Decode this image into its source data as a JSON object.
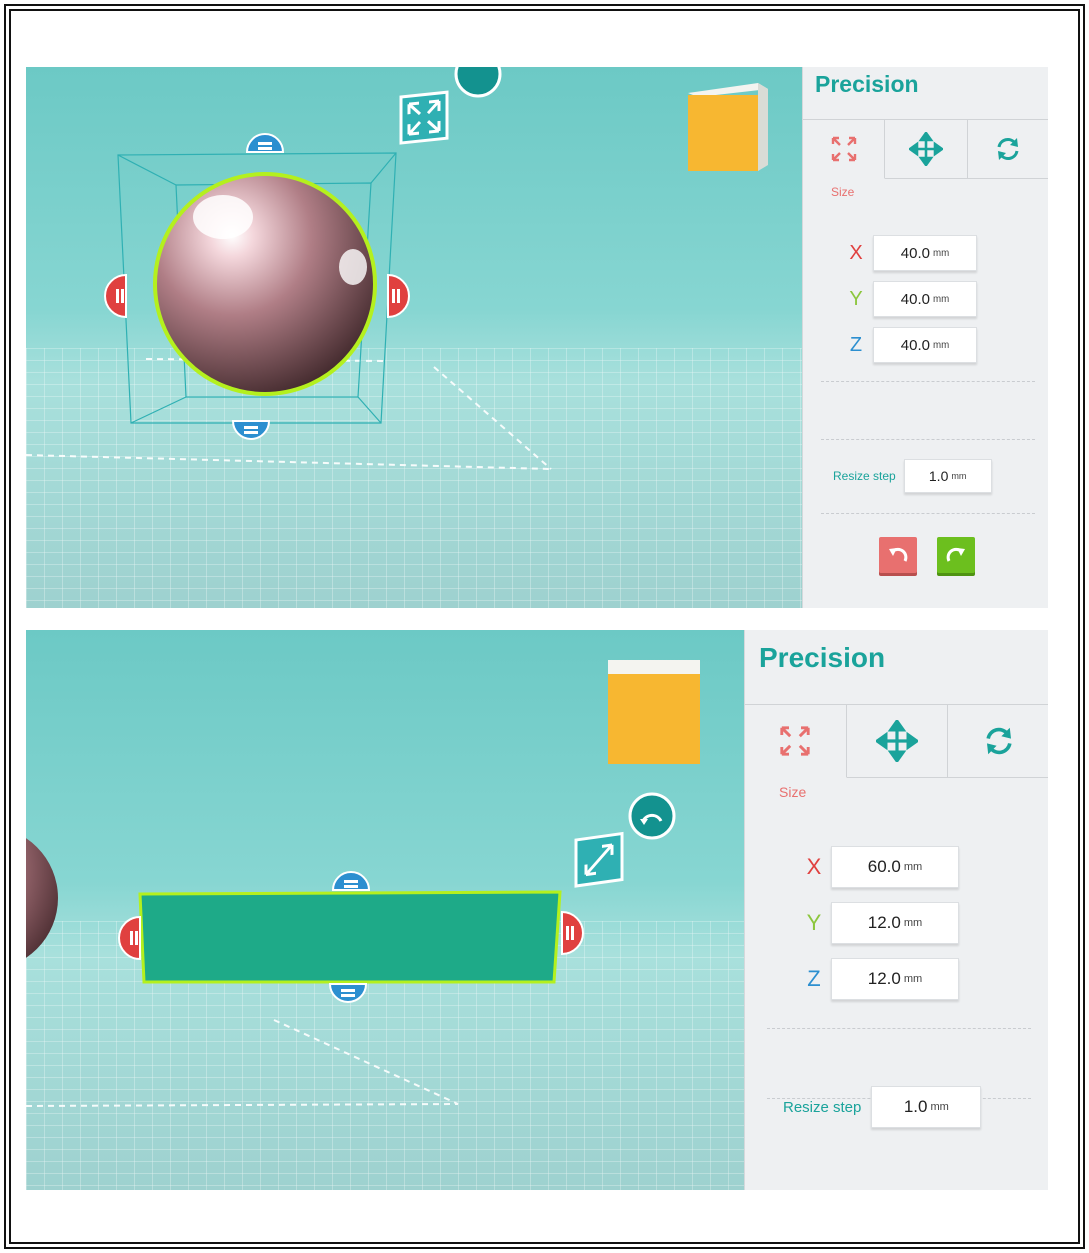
{
  "panels": [
    {
      "title": "Precision",
      "tabs": [
        {
          "icon": "resize-arrows-icon",
          "label": "Size",
          "active": true
        },
        {
          "icon": "move-arrows-icon",
          "label": "",
          "active": false
        },
        {
          "icon": "rotate-icon",
          "label": "",
          "active": false
        }
      ],
      "dimensions": [
        {
          "axis": "X",
          "value": "40.0",
          "unit": "mm"
        },
        {
          "axis": "Y",
          "value": "40.0",
          "unit": "mm"
        },
        {
          "axis": "Z",
          "value": "40.0",
          "unit": "mm"
        }
      ],
      "resize_step": {
        "label": "Resize step",
        "value": "1.0",
        "unit": "mm"
      },
      "undo_icon": "undo-icon",
      "redo_icon": "redo-icon"
    },
    {
      "title": "Precision",
      "tabs": [
        {
          "icon": "resize-arrows-icon",
          "label": "Size",
          "active": true
        },
        {
          "icon": "move-arrows-icon",
          "label": "",
          "active": false
        },
        {
          "icon": "rotate-icon",
          "label": "",
          "active": false
        }
      ],
      "dimensions": [
        {
          "axis": "X",
          "value": "60.0",
          "unit": "mm"
        },
        {
          "axis": "Y",
          "value": "12.0",
          "unit": "mm"
        },
        {
          "axis": "Z",
          "value": "12.0",
          "unit": "mm"
        }
      ],
      "resize_step": {
        "label": "Resize step",
        "value": "1.0",
        "unit": "mm"
      }
    }
  ],
  "colors": {
    "accent": "#1aa39b",
    "size_tab": "#e8706f",
    "axis_x": "#e0403f",
    "axis_y": "#8cc63e",
    "axis_z": "#2c8fd0",
    "undo": "#e8706f",
    "redo": "#6cbf1e",
    "view_cube": "#f7b731",
    "selection_outline": "#b4f01e"
  }
}
